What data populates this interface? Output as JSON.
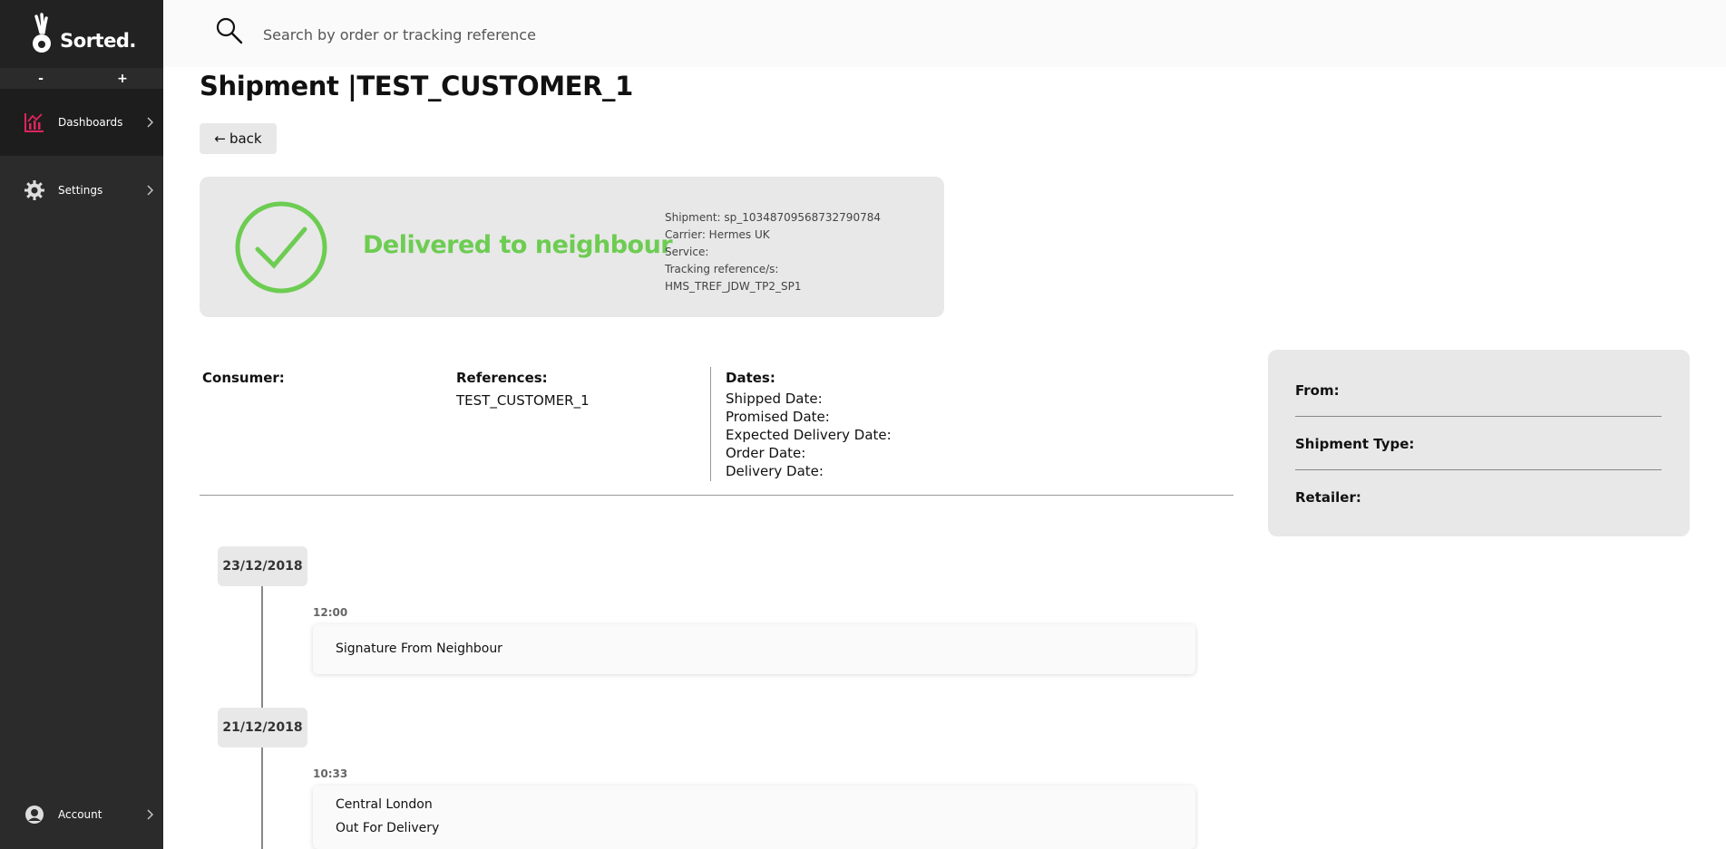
{
  "sidebar": {
    "logo_text": "Sorted.",
    "zoom_out": "-",
    "zoom_in": "+",
    "items": [
      {
        "label": "Dashboards",
        "icon": "chart-icon"
      },
      {
        "label": "Settings",
        "icon": "gear-icon"
      }
    ],
    "account": {
      "label": "Account",
      "icon": "user-icon"
    },
    "accent_color": "#e0245e"
  },
  "search": {
    "placeholder": "Search by order or tracking reference",
    "value": ""
  },
  "page": {
    "title": "Shipment |TEST_CUSTOMER_1",
    "back_label": "back",
    "back_arrow": "←"
  },
  "status": {
    "label": "Delivered to neighbour",
    "color": "#6dcc52",
    "info": [
      "Shipment: sp_10348709568732790784",
      "Carrier: Hermes UK",
      "Service:",
      "Tracking reference/s:",
      "HMS_TREF_JDW_TP2_SP1"
    ]
  },
  "details": {
    "consumer_label": "Consumer:",
    "references_label": "References:",
    "references_value": "TEST_CUSTOMER_1",
    "dates_label": "Dates:",
    "dates": [
      "Shipped Date:",
      "Promised Date:",
      "Expected Delivery Date:",
      "Order Date:",
      "Delivery Date:"
    ]
  },
  "side_panel": {
    "from_label": "From:",
    "shipment_type_label": "Shipment Type:",
    "retailer_label": "Retailer:"
  },
  "timeline": [
    {
      "date": "23/12/2018",
      "events": [
        {
          "time": "12:00",
          "lines": [
            "Signature From Neighbour"
          ]
        }
      ]
    },
    {
      "date": "21/12/2018",
      "events": [
        {
          "time": "10:33",
          "lines": [
            "Central London",
            "Out For Delivery"
          ]
        }
      ]
    }
  ]
}
